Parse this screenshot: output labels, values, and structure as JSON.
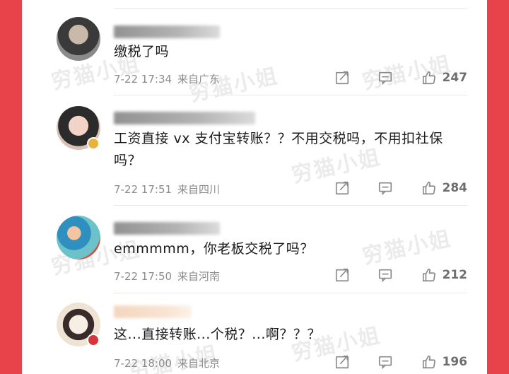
{
  "comments": [
    {
      "text": "缴税了吗",
      "date": "7-22 17:34",
      "location": "来自广东",
      "likes": "247"
    },
    {
      "text": "工资直接 vx 支付宝转账？？不用交税吗，不用扣社保吗？",
      "date": "7-22 17:51",
      "location": "来自四川",
      "likes": "284"
    },
    {
      "text": "emmmmm，你老板交税了吗？",
      "date": "7-22 17:50",
      "location": "来自河南",
      "likes": "212"
    },
    {
      "text": "这...直接转账...个税？...啊？？？",
      "date": "7-22 18:00",
      "location": "来自北京",
      "likes": "196"
    }
  ],
  "watermark": "穷猫小姐",
  "icons": {
    "share": "share-icon",
    "comment": "comment-icon",
    "like": "thumbs-up-icon"
  },
  "colors": {
    "background_red": "#e8424a",
    "panel": "#ffffff",
    "text": "#1b1b1b",
    "meta": "#8c8c8c"
  }
}
